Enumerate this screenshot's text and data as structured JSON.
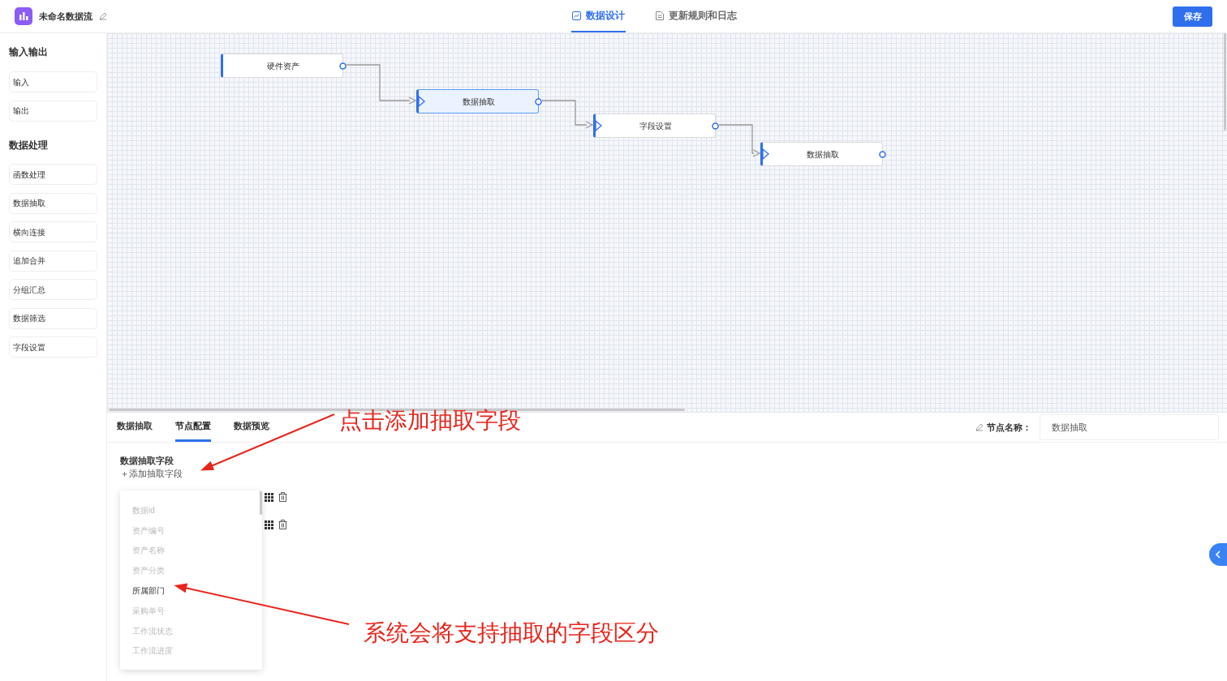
{
  "header": {
    "app_title": "未命名数据流",
    "tabs": [
      {
        "label": "数据设计",
        "selected": true
      },
      {
        "label": "更新规则和日志",
        "selected": false
      }
    ],
    "save_button": "保存"
  },
  "sidebar": {
    "sections": [
      {
        "title": "输入输出",
        "items": [
          "输入",
          "输出"
        ]
      },
      {
        "title": "数据处理",
        "items": [
          "函数处理",
          "数据抽取",
          "横向连接",
          "追加合并",
          "分组汇总",
          "数据筛选",
          "字段设置"
        ]
      }
    ]
  },
  "canvas": {
    "nodes": [
      {
        "label": "硬件资产",
        "kind": "source",
        "selected": false
      },
      {
        "label": "数据抽取",
        "kind": "step",
        "selected": true
      },
      {
        "label": "字段设置",
        "kind": "step",
        "selected": false
      },
      {
        "label": "数据抽取",
        "kind": "step",
        "selected": false
      }
    ]
  },
  "bottom_panel": {
    "tabs": [
      {
        "label": "数据抽取",
        "selected": false
      },
      {
        "label": "节点配置",
        "selected": true
      },
      {
        "label": "数据预览",
        "selected": false
      }
    ],
    "node_name_label": "节点名称：",
    "node_name_value": "数据抽取",
    "section_title": "数据抽取字段",
    "add_field_link": "＋添加抽取字段",
    "field_rows": [
      {
        "kind": "select"
      },
      {
        "kind": "select"
      }
    ],
    "dropdown_options": [
      {
        "label": "数据id",
        "disabled": true
      },
      {
        "label": "资产编号",
        "disabled": true
      },
      {
        "label": "资产名称",
        "disabled": true
      },
      {
        "label": "资产分类",
        "disabled": true
      },
      {
        "label": "所属部门",
        "disabled": false
      },
      {
        "label": "采购单号",
        "disabled": true
      },
      {
        "label": "工作流状态",
        "disabled": true
      },
      {
        "label": "工作流进度",
        "disabled": true
      }
    ]
  },
  "annotations": [
    {
      "text": "点击添加抽取字段"
    },
    {
      "text": "系统会将支持抽取的字段区分"
    }
  ]
}
